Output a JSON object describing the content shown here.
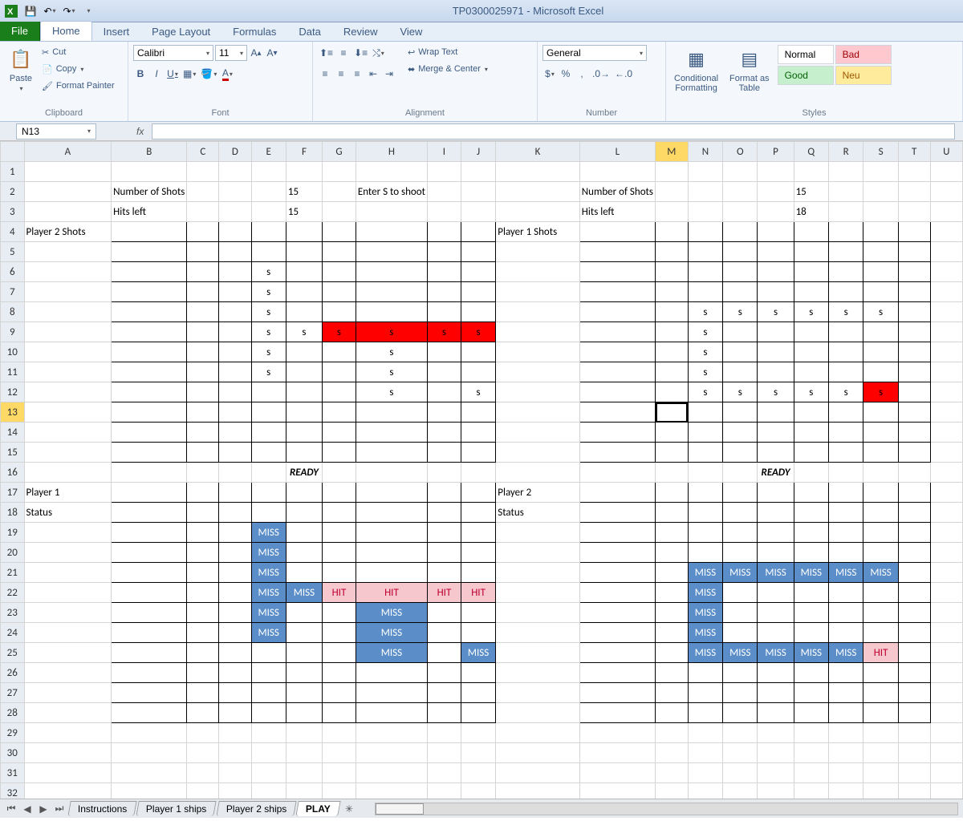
{
  "title": "TP0300025971 - Microsoft Excel",
  "tabs": {
    "file": "File",
    "home": "Home",
    "insert": "Insert",
    "page": "Page Layout",
    "formulas": "Formulas",
    "data": "Data",
    "review": "Review",
    "view": "View"
  },
  "clipboard": {
    "paste": "Paste",
    "cut": "Cut",
    "copy": "Copy",
    "fmt": "Format Painter",
    "label": "Clipboard"
  },
  "font": {
    "name": "Calibri",
    "size": "11",
    "label": "Font"
  },
  "alignment": {
    "wrap": "Wrap Text",
    "merge": "Merge & Center",
    "label": "Alignment"
  },
  "number": {
    "general": "General",
    "label": "Number"
  },
  "styles": {
    "cond": "Conditional\nFormatting",
    "fmtas": "Format as\nTable",
    "normal": "Normal",
    "bad": "Bad",
    "good": "Good",
    "neu": "Neu",
    "label": "Styles"
  },
  "namebox": "N13",
  "columns": [
    "A",
    "B",
    "C",
    "D",
    "E",
    "F",
    "G",
    "H",
    "I",
    "J",
    "K",
    "L",
    "M",
    "N",
    "O",
    "P",
    "Q",
    "R",
    "S",
    "T",
    "U"
  ],
  "selected_col_idx": 13,
  "selected_row": 13,
  "rows": 33,
  "sheet_tabs": [
    "Instructions",
    "Player 1 ships",
    "Player 2 ships",
    "PLAY"
  ],
  "active_sheet": 3,
  "content": {
    "r2": {
      "B": "Number of Shots",
      "F": "15",
      "H": "Enter S to shoot",
      "L": "Number of Shots",
      "Q": "15"
    },
    "r3": {
      "B": "Hits left",
      "F": "15",
      "L": "Hits left",
      "Q": "18"
    },
    "r4": {
      "A": "Player 2 Shots",
      "K": "Player 1 Shots"
    },
    "r16": {
      "ready1": "READY",
      "ready2": "READY"
    },
    "r17": {
      "A": "Player 1",
      "K": "Player 2"
    },
    "r18": {
      "A": "Status",
      "K": "Status"
    }
  },
  "game": {
    "miss": "MISS",
    "hit": "HIT",
    "s": "s",
    "grid1_shots": {
      "6": {
        "E": "s"
      },
      "7": {
        "E": "s"
      },
      "8": {
        "E": "s"
      },
      "9": {
        "E": "s",
        "F": "s",
        "G": "s_red",
        "H": "s_red",
        "I": "s_red",
        "J": "s_red"
      },
      "10": {
        "E": "s",
        "H": "s"
      },
      "11": {
        "E": "s",
        "H": "s"
      },
      "12": {
        "H": "s",
        "J": "s"
      }
    },
    "grid2_shots": {
      "8": {
        "N": "s",
        "O": "s",
        "P": "s",
        "Q": "s",
        "R": "s",
        "S": "s"
      },
      "9": {
        "N": "s"
      },
      "10": {
        "N": "s"
      },
      "11": {
        "N": "s"
      },
      "12": {
        "N": "s",
        "O": "s",
        "P": "s",
        "Q": "s",
        "R": "s",
        "S": "s_red"
      }
    },
    "grid1_status": {
      "19": {
        "E": "MISS"
      },
      "20": {
        "E": "MISS"
      },
      "21": {
        "E": "MISS"
      },
      "22": {
        "E": "MISS",
        "F": "MISS",
        "G": "HIT",
        "H": "HIT",
        "I": "HIT",
        "J": "HIT"
      },
      "23": {
        "E": "MISS",
        "H": "MISS"
      },
      "24": {
        "E": "MISS",
        "H": "MISS"
      },
      "25": {
        "H": "MISS",
        "J": "MISS"
      }
    },
    "grid2_status": {
      "21": {
        "N": "MISS",
        "O": "MISS",
        "P": "MISS",
        "Q": "MISS",
        "R": "MISS",
        "S": "MISS"
      },
      "22": {
        "N": "MISS"
      },
      "23": {
        "N": "MISS"
      },
      "24": {
        "N": "MISS"
      },
      "25": {
        "N": "MISS",
        "O": "MISS",
        "P": "MISS",
        "Q": "MISS",
        "R": "MISS",
        "S": "HIT"
      }
    }
  }
}
